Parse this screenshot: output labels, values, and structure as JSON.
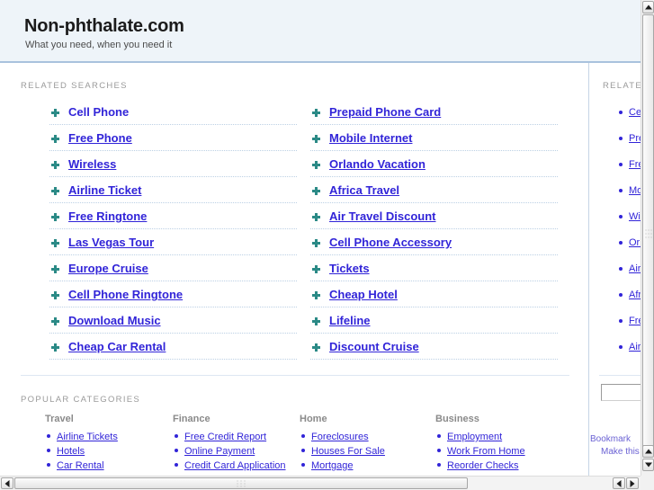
{
  "header": {
    "site_title": "Non-phthalate.com",
    "tagline": "What you need, when you need it"
  },
  "main": {
    "related_label": "RELATED SEARCHES",
    "popular_label": "POPULAR CATEGORIES",
    "related_left": [
      {
        "label": "Cell Phone"
      },
      {
        "label": "Free Phone"
      },
      {
        "label": "Wireless"
      },
      {
        "label": "Airline Ticket"
      },
      {
        "label": "Free Ringtone"
      },
      {
        "label": "Las Vegas Tour"
      },
      {
        "label": "Europe Cruise"
      },
      {
        "label": "Cell Phone Ringtone"
      },
      {
        "label": "Download Music"
      },
      {
        "label": "Cheap Car Rental"
      }
    ],
    "related_right": [
      {
        "label": "Prepaid Phone Card"
      },
      {
        "label": "Mobile Internet"
      },
      {
        "label": "Orlando Vacation"
      },
      {
        "label": "Africa Travel"
      },
      {
        "label": "Air Travel Discount"
      },
      {
        "label": "Cell Phone Accessory"
      },
      {
        "label": "Tickets"
      },
      {
        "label": "Cheap Hotel"
      },
      {
        "label": "Lifeline"
      },
      {
        "label": "Discount Cruise"
      }
    ],
    "categories": [
      {
        "title": "Travel",
        "items": [
          "Airline Tickets",
          "Hotels",
          "Car Rental"
        ]
      },
      {
        "title": "Finance",
        "items": [
          "Free Credit Report",
          "Online Payment",
          "Credit Card Application"
        ]
      },
      {
        "title": "Home",
        "items": [
          "Foreclosures",
          "Houses For Sale",
          "Mortgage"
        ]
      },
      {
        "title": "Business",
        "items": [
          "Employment",
          "Work From Home",
          "Reorder Checks"
        ]
      }
    ]
  },
  "rail": {
    "related_label": "RELATED SEARCHES",
    "items": [
      {
        "label": "Cell Phone"
      },
      {
        "label": "Prepaid Phone Card"
      },
      {
        "label": "Free Phone"
      },
      {
        "label": "Mobile Internet"
      },
      {
        "label": "Wireless"
      },
      {
        "label": "Orlando Vacation"
      },
      {
        "label": "Airline Ticket"
      },
      {
        "label": "Africa Travel"
      },
      {
        "label": "Free Ringtone"
      },
      {
        "label": "Air Travel Discount"
      }
    ],
    "search_value": "",
    "search_placeholder": "",
    "bookmark_link": "Bookmark",
    "homepage_link": "Make this my homepage"
  },
  "colors": {
    "link": "#3124d8",
    "arrow_bullet": "#2b8a86",
    "header_bg": "#eef4f9",
    "header_border": "#a9c2dd",
    "label_text": "#9a9a9a",
    "dotted_rule": "#bcd0e4"
  },
  "icons": {
    "arrow_bullet": "arrow-bullet-icon",
    "dot_bullet": "dot-bullet-icon",
    "scroll_up": "scroll-up-arrow-icon",
    "scroll_down": "scroll-down-arrow-icon",
    "scroll_left": "scroll-left-arrow-icon",
    "scroll_right": "scroll-right-arrow-icon"
  }
}
